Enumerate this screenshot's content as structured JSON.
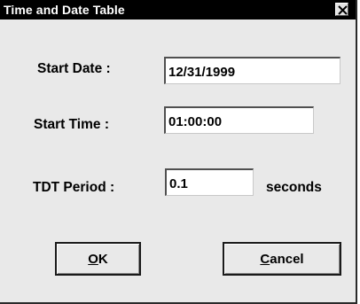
{
  "window": {
    "title": "Time and Date Table",
    "close_icon": "close-icon"
  },
  "form": {
    "start_date": {
      "label": "Start Date :",
      "value": "12/31/1999"
    },
    "start_time": {
      "label": "Start Time :",
      "value": "01:00:00"
    },
    "tdt_period": {
      "label": "TDT Period :",
      "value": "0.1",
      "unit": "seconds"
    }
  },
  "buttons": {
    "ok": {
      "mnemonic": "O",
      "rest": "K"
    },
    "cancel": {
      "mnemonic": "C",
      "rest": "ancel"
    }
  },
  "colors": {
    "titlebar": "#000000",
    "dialog_bg": "#e9e9e9",
    "field_bg": "#ffffff"
  }
}
